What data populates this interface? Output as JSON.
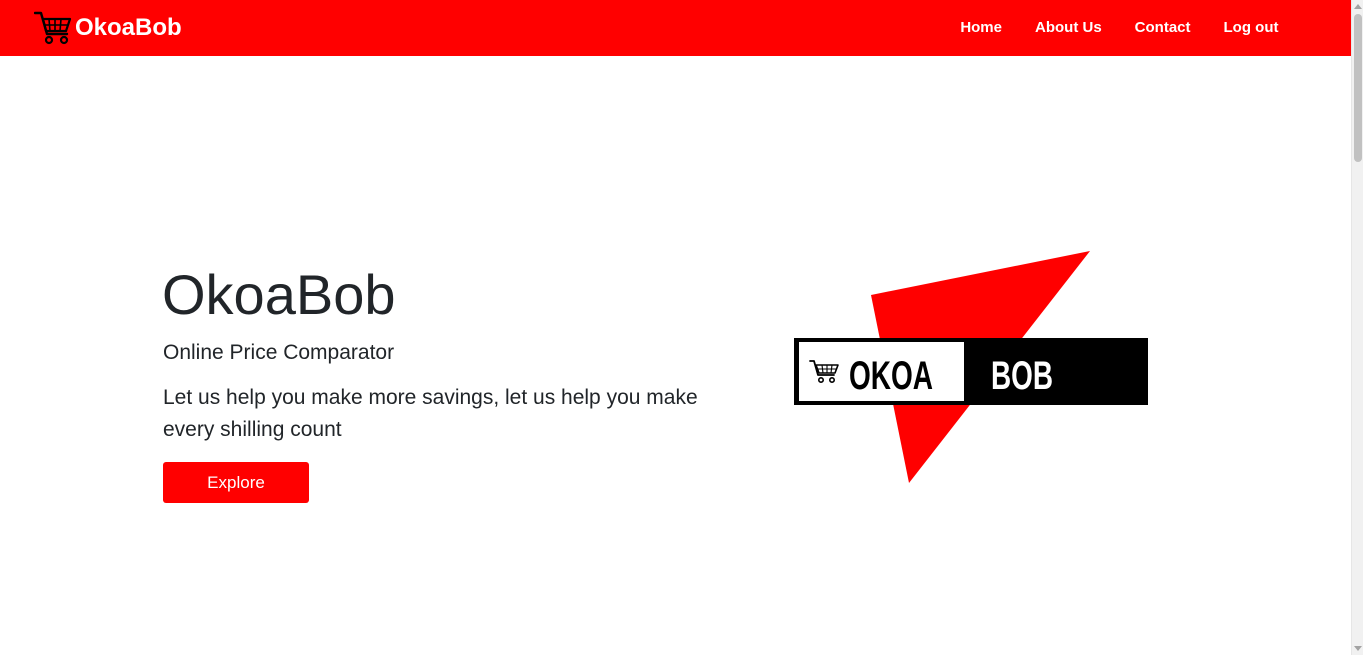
{
  "colors": {
    "brand_red": "#ff0000",
    "text": "#212529",
    "white": "#ffffff",
    "black": "#000000"
  },
  "navbar": {
    "brand_icon": "shopping-cart-icon",
    "brand_name": "OkoaBob",
    "links": [
      {
        "label": "Home"
      },
      {
        "label": "About Us"
      },
      {
        "label": "Contact"
      },
      {
        "label": "Log out"
      }
    ]
  },
  "hero": {
    "title": "OkoaBob",
    "subtitle": "Online Price Comparator",
    "tagline": "Let us help you make more savings, let us help you make every shilling count",
    "button_label": "Explore",
    "logo": {
      "icon": "shopping-cart-icon",
      "left_text": "OKOA",
      "right_text": "BOB"
    }
  }
}
